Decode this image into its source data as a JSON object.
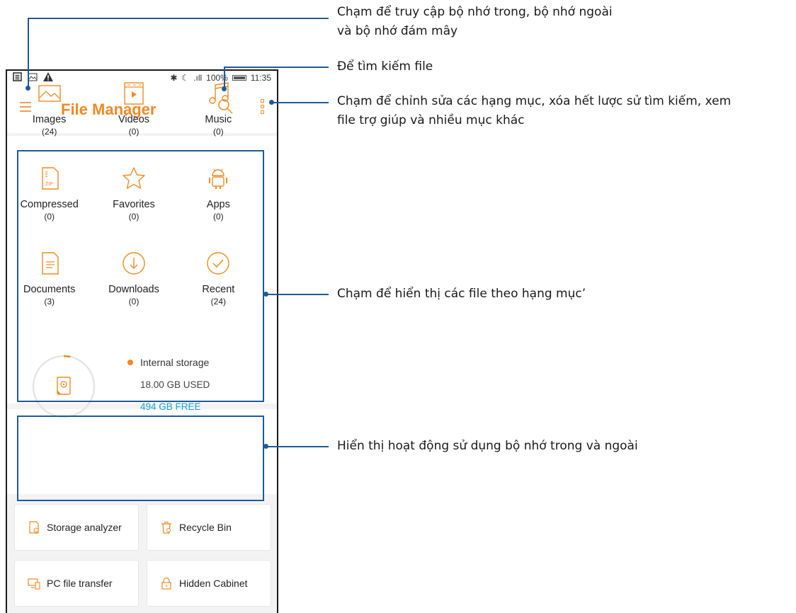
{
  "status_bar": {
    "signal": ".ıll",
    "battery": "100%",
    "time": "11:35"
  },
  "app_bar": {
    "title": "File Manager"
  },
  "categories": [
    {
      "label": "Images",
      "count": "(24)",
      "icon": "image-icon"
    },
    {
      "label": "Videos",
      "count": "(0)",
      "icon": "video-icon"
    },
    {
      "label": "Music",
      "count": "(0)",
      "icon": "music-icon"
    },
    {
      "label": "Compressed",
      "count": "(0)",
      "icon": "zip-icon"
    },
    {
      "label": "Favorites",
      "count": "(0)",
      "icon": "star-icon"
    },
    {
      "label": "Apps",
      "count": "(0)",
      "icon": "android-icon"
    },
    {
      "label": "Documents",
      "count": "(3)",
      "icon": "document-icon"
    },
    {
      "label": "Downloads",
      "count": "(0)",
      "icon": "download-icon"
    },
    {
      "label": "Recent",
      "count": "(24)",
      "icon": "check-circle-icon"
    }
  ],
  "storage": {
    "name": "Internal storage",
    "used": "18.00 GB USED",
    "free": "494 GB FREE",
    "used_fraction": 0.035
  },
  "tools": [
    {
      "label": "Storage analyzer",
      "icon": "storage-analyzer-icon"
    },
    {
      "label": "Recycle Bin",
      "icon": "recycle-bin-icon"
    },
    {
      "label": "PC file transfer",
      "icon": "pc-transfer-icon"
    },
    {
      "label": "Hidden Cabinet",
      "icon": "lock-icon"
    }
  ],
  "callouts": {
    "storage_access_line1": "Chạm để truy cập bộ nhớ trong, bộ nhớ ngoài",
    "storage_access_line2": "và bộ nhớ đám mây",
    "search": "Để tìm kiếm file",
    "options_line1": "Chạm để chỉnh sửa các hạng mục, xóa hết lược sử tìm kiếm, xem",
    "options_line2": "file trợ giúp và nhiều mục khác",
    "categories": "Chạm để hiển thị các file theo hạng mục’",
    "storage_usage": "Hiển thị hoạt động sử dụng bộ nhớ trong và ngoài"
  },
  "colors": {
    "accent": "#f08a24",
    "free": "#1aa3d6",
    "annotation": "#1e5a9a"
  }
}
